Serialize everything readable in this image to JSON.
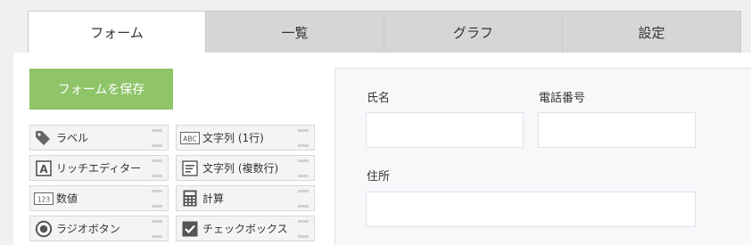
{
  "tabs": [
    {
      "label": "フォーム",
      "active": true
    },
    {
      "label": "一覧",
      "active": false
    },
    {
      "label": "グラフ",
      "active": false
    },
    {
      "label": "設定",
      "active": false
    }
  ],
  "save_button": "フォームを保存",
  "palette": [
    {
      "label": "ラベル",
      "icon": "tag-icon"
    },
    {
      "label": "文字列 (1行)",
      "icon": "abc-icon"
    },
    {
      "label": "リッチエディター",
      "icon": "rich-text-icon"
    },
    {
      "label": "文字列 (複数行)",
      "icon": "multiline-icon"
    },
    {
      "label": "数値",
      "icon": "number-icon"
    },
    {
      "label": "計算",
      "icon": "calculator-icon"
    },
    {
      "label": "ラジオボタン",
      "icon": "radio-icon"
    },
    {
      "label": "チェックボックス",
      "icon": "checkbox-icon"
    }
  ],
  "form": {
    "name_label": "氏名",
    "phone_label": "電話番号",
    "address_label": "住所",
    "name_value": "",
    "phone_value": "",
    "address_value": ""
  },
  "colors": {
    "save_button": "#8fc469",
    "tab_inactive": "#d6d6d6",
    "canvas_bg": "#f7f8fa"
  }
}
